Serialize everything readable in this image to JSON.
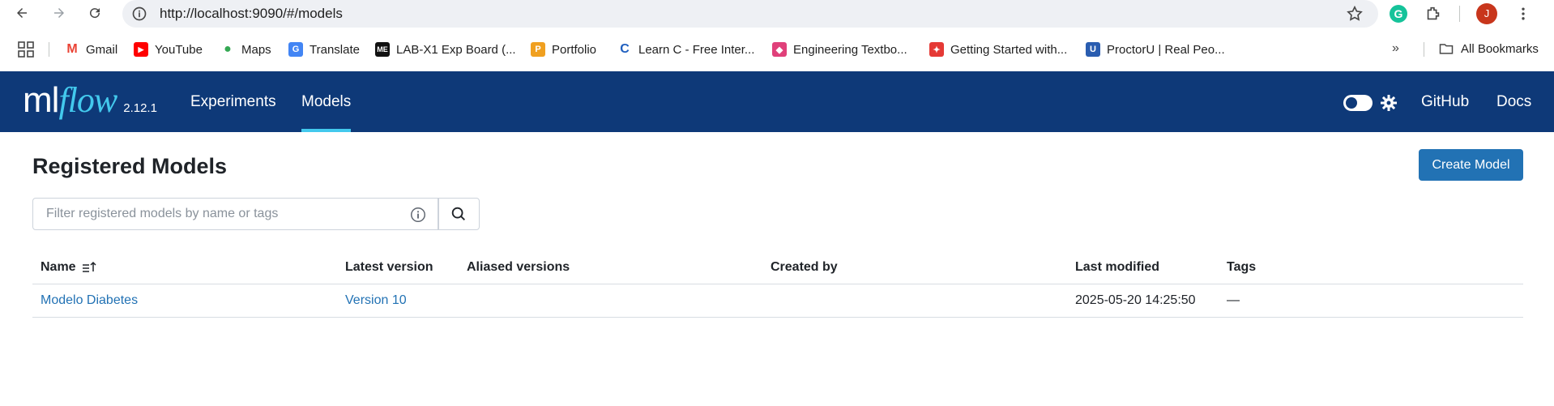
{
  "browser": {
    "url": "http://localhost:9090/#/models",
    "profile_initial": "J",
    "bookmarks": [
      {
        "label": "Gmail",
        "icon": "gmail-icon",
        "color": "#ea4335"
      },
      {
        "label": "YouTube",
        "icon": "youtube-icon",
        "color": "#ff0000"
      },
      {
        "label": "Maps",
        "icon": "maps-icon",
        "color": "#34a853"
      },
      {
        "label": "Translate",
        "icon": "translate-icon",
        "color": "#4285f4"
      },
      {
        "label": "LAB-X1 Exp Board (...",
        "icon": "me-icon",
        "color": "#111111"
      },
      {
        "label": "Portfolio",
        "icon": "portfolio-icon",
        "color": "#f0a020"
      },
      {
        "label": "Learn C - Free Inter...",
        "icon": "learn-c-icon",
        "color": "#1f5fbf"
      },
      {
        "label": "Engineering Textbo...",
        "icon": "engineering-icon",
        "color": "#e0407a"
      },
      {
        "label": "Getting Started with...",
        "icon": "getting-started-icon",
        "color": "#e53935"
      },
      {
        "label": "ProctorU | Real Peo...",
        "icon": "proctoru-icon",
        "color": "#2a5db0"
      }
    ],
    "all_bookmarks": "All Bookmarks"
  },
  "header": {
    "logo_ml": "ml",
    "logo_flow": "flow",
    "version": "2.12.1",
    "nav": [
      {
        "label": "Experiments",
        "active": false
      },
      {
        "label": "Models",
        "active": true
      }
    ],
    "github": "GitHub",
    "docs": "Docs",
    "accent": "#43c9ed",
    "background": "#0e3978"
  },
  "main": {
    "title": "Registered Models",
    "create_button": "Create Model",
    "search_placeholder": "Filter registered models by name or tags"
  },
  "table": {
    "columns": [
      "Name",
      "Latest version",
      "Aliased versions",
      "Created by",
      "Last modified",
      "Tags"
    ],
    "rows": [
      {
        "name": "Modelo Diabetes",
        "latest_version": "Version 10",
        "aliased_versions": "",
        "created_by": "",
        "last_modified": "2025-05-20 14:25:50",
        "tags": "—"
      }
    ]
  }
}
